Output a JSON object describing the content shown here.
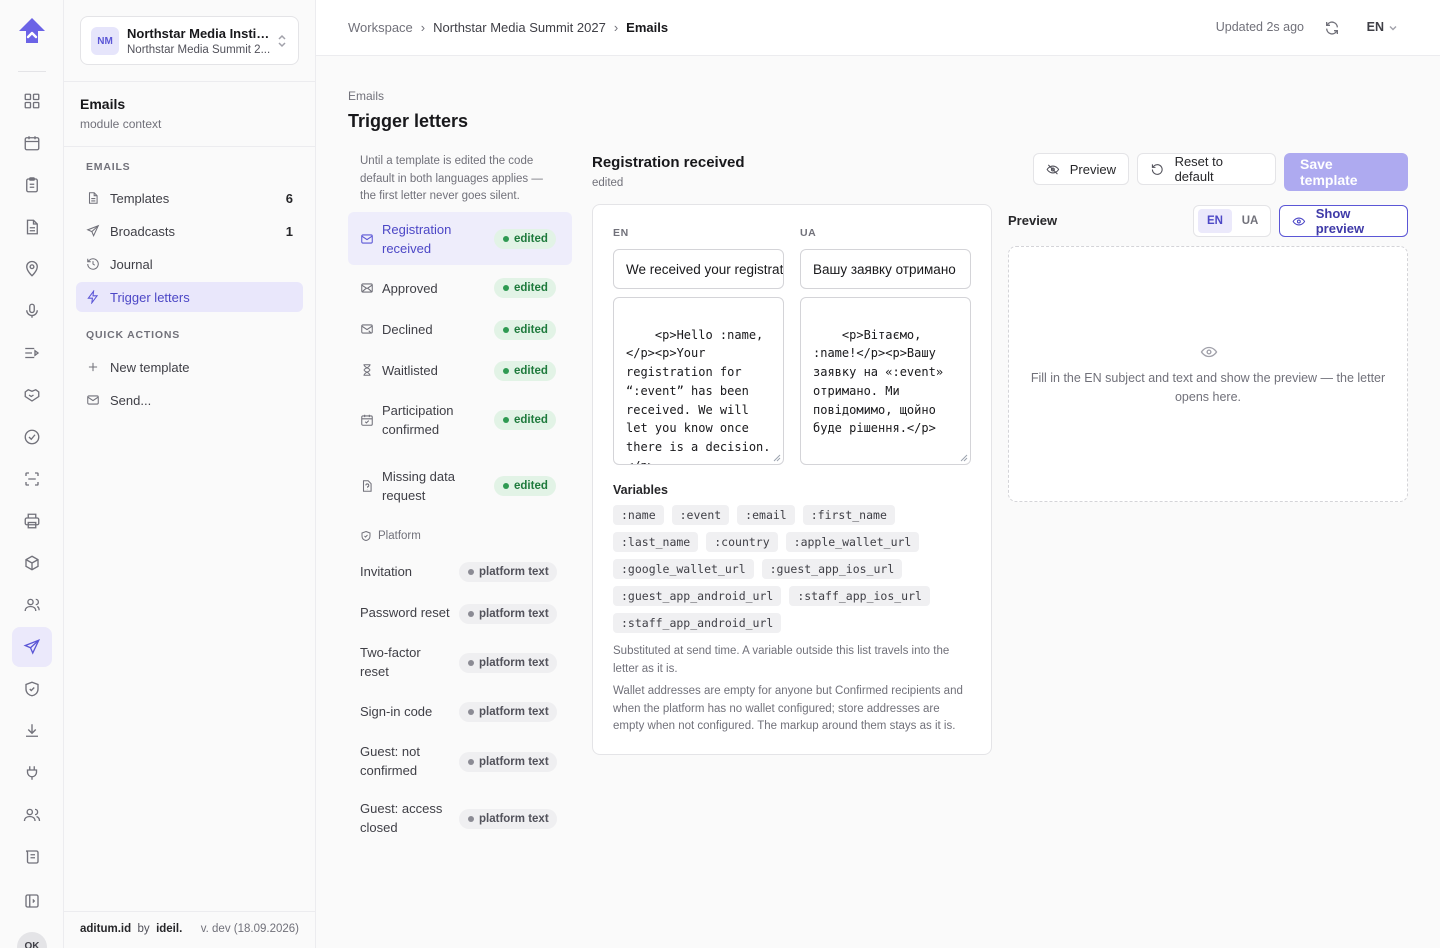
{
  "rail": {
    "icons": [
      "dashboard-icon",
      "calendar-icon",
      "clipboard-icon",
      "document-icon",
      "location-icon",
      "microphone-icon",
      "agenda-icon",
      "handshake-icon",
      "check-circle-icon",
      "scan-icon",
      "printer-icon",
      "package-icon",
      "attendees-icon",
      "send-icon",
      "shield-icon",
      "download-icon",
      "plug-icon",
      "users-icon",
      "scroll-icon",
      "sidebar-toggle-icon"
    ],
    "active": "send-icon",
    "avatar": "OK"
  },
  "org": {
    "initials": "NM",
    "name": "Northstar Media Instit...",
    "event": "Northstar Media Summit 2..."
  },
  "module": {
    "title": "Emails",
    "subtitle": "module context"
  },
  "nav": {
    "section_emails": "EMAILS",
    "items": [
      {
        "label": "Templates",
        "count": "6"
      },
      {
        "label": "Broadcasts",
        "count": "1"
      },
      {
        "label": "Journal",
        "count": ""
      },
      {
        "label": "Trigger letters",
        "count": ""
      }
    ],
    "section_quick": "QUICK ACTIONS",
    "quick": [
      {
        "label": "New template"
      },
      {
        "label": "Send..."
      }
    ]
  },
  "footer": {
    "brand": "aditum.id",
    "by": "by",
    "maker": "ideil.",
    "version": "v. dev (18.09.2026)"
  },
  "topbar": {
    "crumbs": [
      "Workspace",
      "Northstar Media Summit 2027",
      "Emails"
    ],
    "separator": "›",
    "updated": "Updated 2s ago",
    "lang": "EN"
  },
  "page": {
    "kicker": "Emails",
    "title": "Trigger letters"
  },
  "triggers": {
    "note": "Until a template is edited the code default in both languages applies — the first letter never goes silent.",
    "items": [
      {
        "label": "Registration received",
        "status": "edited",
        "icon": "mail-icon"
      },
      {
        "label": "Approved",
        "status": "edited",
        "icon": "mail-open-icon"
      },
      {
        "label": "Declined",
        "status": "edited",
        "icon": "mail-x-icon"
      },
      {
        "label": "Waitlisted",
        "status": "edited",
        "icon": "hourglass-icon"
      },
      {
        "label": "Participation confirmed",
        "status": "edited",
        "icon": "calendar-check-icon"
      },
      {
        "label": "Missing data request",
        "status": "edited",
        "icon": "file-question-icon"
      }
    ],
    "platform_heading": "Platform",
    "platform": [
      {
        "label": "Invitation",
        "status": "platform text"
      },
      {
        "label": "Password reset",
        "status": "platform text"
      },
      {
        "label": "Two-factor reset",
        "status": "platform text"
      },
      {
        "label": "Sign-in code",
        "status": "platform text"
      },
      {
        "label": "Guest: not confirmed",
        "status": "platform text"
      },
      {
        "label": "Guest: access closed",
        "status": "platform text"
      }
    ]
  },
  "editor": {
    "title": "Registration received",
    "subtitle": "edited",
    "preview_button": "Preview",
    "reset_button": "Reset to default",
    "save_button": "Save template",
    "en_label": "EN",
    "ua_label": "UA",
    "en_subject": "We received your registration",
    "ua_subject": "Вашу заявку отримано",
    "en_body": "<p>Hello :name,</p><p>Your registration for “:event” has been received. We will let you know once there is a decision.</p>",
    "ua_body": "<p>Вітаємо, :name!</p><p>Вашу заявку на «:event» отримано. Ми повідомимо, щойно буде рішення.</p>",
    "variables_title": "Variables",
    "variables": [
      ":name",
      ":event",
      ":email",
      ":first_name",
      ":last_name",
      ":country",
      ":apple_wallet_url",
      ":google_wallet_url",
      ":guest_app_ios_url",
      ":guest_app_android_url",
      ":staff_app_ios_url",
      ":staff_app_android_url"
    ],
    "note1": "Substituted at send time. A variable outside this list travels into the letter as it is.",
    "note2": "Wallet addresses are empty for anyone but Confirmed recipients and when the platform has no wallet configured; store addresses are empty when not configured. The markup around them stays as it is."
  },
  "preview": {
    "title": "Preview",
    "langs": [
      "EN",
      "UA"
    ],
    "active_lang": "EN",
    "show_button": "Show preview",
    "empty_message": "Fill in the EN subject and text and show the preview — the letter opens here."
  },
  "colors": {
    "accent": "#5b56d6",
    "accent_soft": "#ebe9fb",
    "edited_bg": "#e2f3e6",
    "edited_fg": "#1e7a3c",
    "save_disabled": "#aeaaf0"
  }
}
